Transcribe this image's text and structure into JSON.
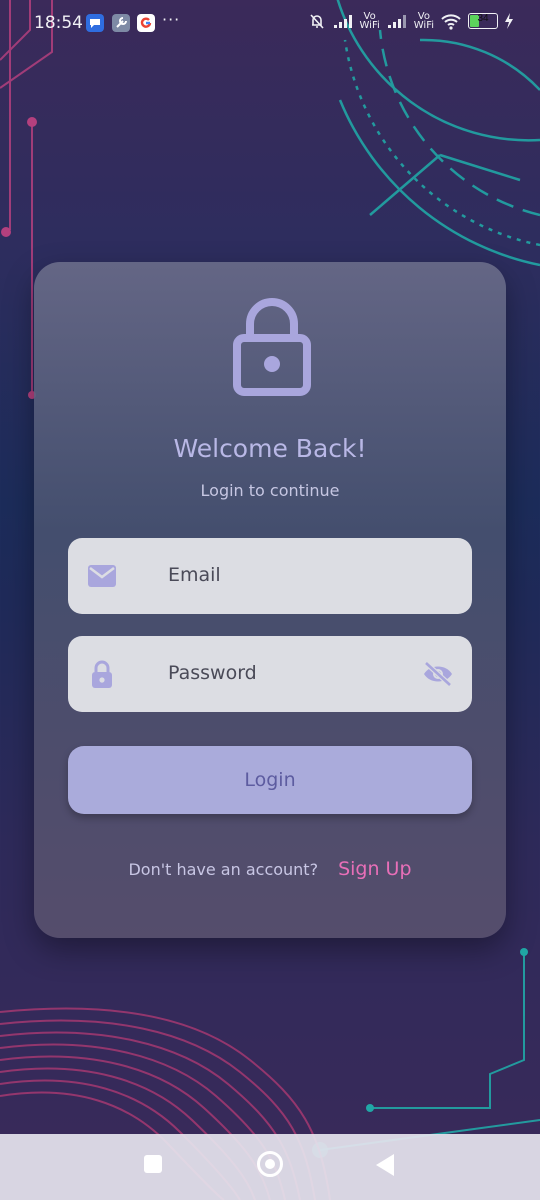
{
  "status_bar": {
    "time": "18:54",
    "more": "···",
    "vo_wifi_1": "Vo\nWiFi",
    "vo_wifi_2": "Vo\nWiFi",
    "battery": "34",
    "battery_level": 34
  },
  "login": {
    "title": "Welcome Back!",
    "subtitle": "Login to continue",
    "email_placeholder": "Email",
    "password_placeholder": "Password",
    "login_label": "Login",
    "no_account": "Don't have an account?",
    "signup_label": "Sign Up"
  },
  "colors": {
    "accent": "#aaabdb",
    "icon": "#a9a6dd",
    "link": "#e86fb8"
  },
  "icons": {
    "lock": "lock-icon",
    "email": "mail-icon",
    "password": "lock-icon",
    "visibility": "eye-off-icon"
  }
}
